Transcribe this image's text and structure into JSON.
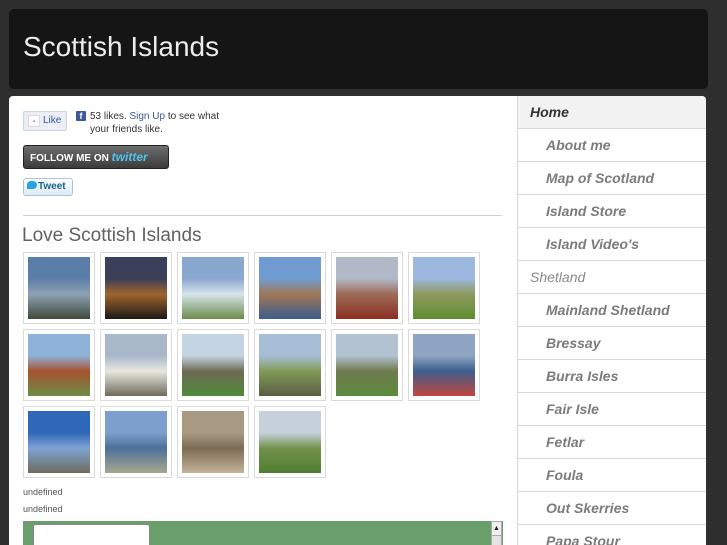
{
  "site": {
    "title": "Scottish Islands"
  },
  "social": {
    "fb_like_label": "Like",
    "fb_logo": "f",
    "fb_likes": "53 likes.",
    "fb_signup": "Sign Up",
    "fb_suffix": "to see what your friends like.",
    "follow_prefix": "FOLLOW ME ON",
    "follow_brand": "twitter",
    "tweet_label": "Tweet"
  },
  "gallery": {
    "title": "Love Scottish Islands",
    "images": [
      {
        "name": "photo-mountain-coast",
        "colors": [
          "#5b7ea8",
          "#8ea1b3",
          "#3e4a3a"
        ]
      },
      {
        "name": "photo-sunset-stones",
        "colors": [
          "#3b3f5a",
          "#a0642e",
          "#1c1a16"
        ]
      },
      {
        "name": "photo-beach-bay",
        "colors": [
          "#8aa7cf",
          "#d7e4ea",
          "#6b8c4a"
        ]
      },
      {
        "name": "photo-harbour-village",
        "colors": [
          "#6f9bd1",
          "#a07856",
          "#3c5c8c"
        ]
      },
      {
        "name": "photo-red-moor-hills",
        "colors": [
          "#b1b9c8",
          "#9e6a56",
          "#8c2f22"
        ]
      },
      {
        "name": "photo-green-field-house",
        "colors": [
          "#9db8de",
          "#8e9a5f",
          "#5d8e2e"
        ]
      },
      {
        "name": "photo-sea-stack",
        "colors": [
          "#8fb2d9",
          "#a6522f",
          "#6b8e45"
        ]
      },
      {
        "name": "photo-white-cottages",
        "colors": [
          "#a9b8c8",
          "#e7e7e0",
          "#6f6c5c"
        ]
      },
      {
        "name": "photo-ruined-abbey",
        "colors": [
          "#c4d4e2",
          "#6e6a55",
          "#4f8a3a"
        ]
      },
      {
        "name": "photo-rocky-grassland",
        "colors": [
          "#a8bdd6",
          "#7f9a56",
          "#5a5d45"
        ]
      },
      {
        "name": "photo-green-hillside",
        "colors": [
          "#b3c2d1",
          "#6f7a4e",
          "#5c8a3c"
        ]
      },
      {
        "name": "photo-colorful-harbour",
        "colors": [
          "#8fa4c2",
          "#3d5f8e",
          "#c2463c"
        ]
      },
      {
        "name": "photo-blue-sky-cliffs",
        "colors": [
          "#2f68b8",
          "#7ea3d4",
          "#6e6c5b"
        ]
      },
      {
        "name": "photo-island-coastline",
        "colors": [
          "#7c9fce",
          "#4d6f9a",
          "#a7a88d"
        ]
      },
      {
        "name": "photo-stone-dwelling",
        "colors": [
          "#a89a82",
          "#7c6c55",
          "#c4b39a"
        ]
      },
      {
        "name": "photo-meadow-ruins",
        "colors": [
          "#c6d1dc",
          "#73924d",
          "#4e7e32"
        ]
      }
    ]
  },
  "notes": {
    "line1": "undefined",
    "line2": "undefined"
  },
  "scroll": {
    "up_glyph": "▲"
  },
  "nav": {
    "items": [
      {
        "label": "Home",
        "level": "home"
      },
      {
        "label": "About me",
        "level": "sub"
      },
      {
        "label": "Map of Scotland",
        "level": "sub"
      },
      {
        "label": "Island Store",
        "level": "sub"
      },
      {
        "label": "Island Video's",
        "level": "sub"
      },
      {
        "label": "Shetland",
        "level": "top"
      },
      {
        "label": "Mainland Shetland",
        "level": "sub"
      },
      {
        "label": "Bressay",
        "level": "sub"
      },
      {
        "label": "Burra Isles",
        "level": "sub"
      },
      {
        "label": "Fair Isle",
        "level": "sub"
      },
      {
        "label": "Fetlar",
        "level": "sub"
      },
      {
        "label": "Foula",
        "level": "sub"
      },
      {
        "label": "Out Skerries",
        "level": "sub"
      },
      {
        "label": "Papa Stour",
        "level": "sub"
      }
    ]
  }
}
